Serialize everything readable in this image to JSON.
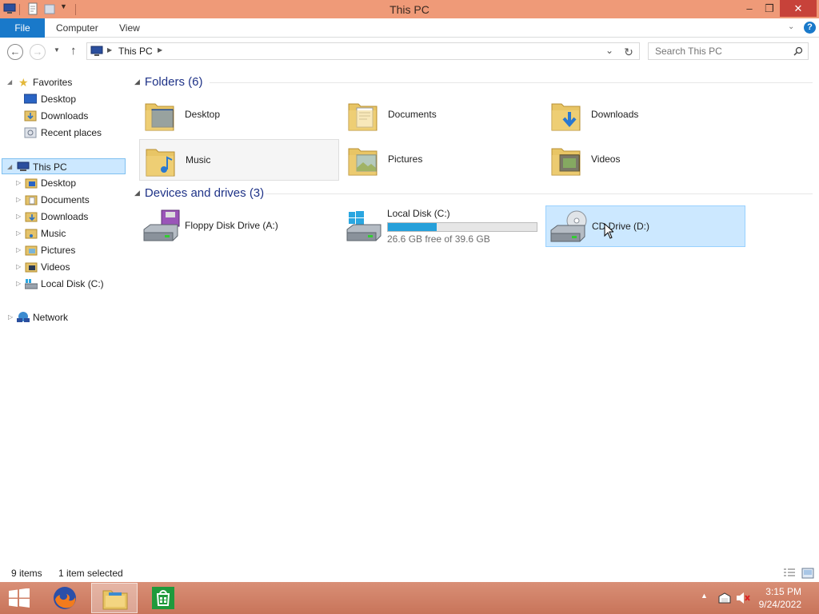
{
  "window": {
    "title": "This PC",
    "controls": {
      "minimize": "‒",
      "maximize": "❐",
      "close": "✕"
    }
  },
  "ribbon": {
    "tabs": [
      "File",
      "Computer",
      "View"
    ]
  },
  "address": {
    "path": [
      "This PC"
    ],
    "search_placeholder": "Search This PC"
  },
  "nav_pane": {
    "favorites": {
      "label": "Favorites",
      "items": [
        "Desktop",
        "Downloads",
        "Recent places"
      ]
    },
    "this_pc": {
      "label": "This PC",
      "items": [
        "Desktop",
        "Documents",
        "Downloads",
        "Music",
        "Pictures",
        "Videos",
        "Local Disk (C:)"
      ]
    },
    "network": {
      "label": "Network"
    }
  },
  "content": {
    "folders_header": "Folders (6)",
    "folders": [
      "Desktop",
      "Documents",
      "Downloads",
      "Music",
      "Pictures",
      "Videos"
    ],
    "devices_header": "Devices and drives (3)",
    "drives": {
      "floppy": {
        "name": "Floppy Disk Drive (A:)"
      },
      "local": {
        "name": "Local Disk (C:)",
        "free_text": "26.6 GB free of 39.6 GB",
        "used_fraction": 0.33
      },
      "cd": {
        "name": "CD Drive (D:)"
      }
    }
  },
  "status": {
    "items": "9 items",
    "selected": "1 item selected"
  },
  "taskbar": {
    "time": "3:15 PM",
    "date": "9/24/2022"
  },
  "colors": {
    "titlebar": "#ef9a78",
    "file_tab": "#1979ca",
    "selection": "#cce8ff",
    "taskbar": "#d08066"
  }
}
